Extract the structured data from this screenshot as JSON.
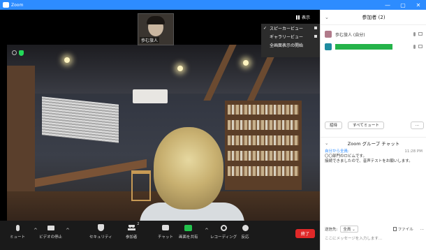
{
  "window": {
    "title": "Zoom",
    "controls": [
      "—",
      "▢",
      "✕"
    ]
  },
  "video": {
    "self_name": "歩む旅人",
    "view_button": "表示",
    "view_menu": [
      {
        "label": "スピーカービュー",
        "checked": true
      },
      {
        "label": "ギャラリービュー",
        "checked": false
      },
      {
        "label": "全画面表示の開始",
        "checked": false
      }
    ]
  },
  "toolbar": {
    "mute": "ミュート",
    "video": "ビデオの停止",
    "security": "セキュリティ",
    "participants": "参加者",
    "participant_count": "2",
    "chat": "チャット",
    "share": "画面を共有",
    "record": "レコーディング",
    "reactions": "反応",
    "end": "終了"
  },
  "panel": {
    "title": "参加者 (2)",
    "participants": [
      {
        "name": "歩む旅人 (自分)"
      },
      {
        "name": ""
      }
    ],
    "invite": "招待",
    "mute_all": "すべてミュート",
    "more": "..."
  },
  "chat": {
    "title": "Zoom グループ チャット",
    "sender": "自分から全員:",
    "time": "11:28 PM",
    "line1": "〇〇部門のロビムです。",
    "line2": "接続できましたので、音声テストをお願いします。",
    "to_label": "送信先:",
    "to_value": "全員",
    "file": "ファイル",
    "more": "...",
    "input_placeholder": "ここにメッセージを入力します..."
  }
}
